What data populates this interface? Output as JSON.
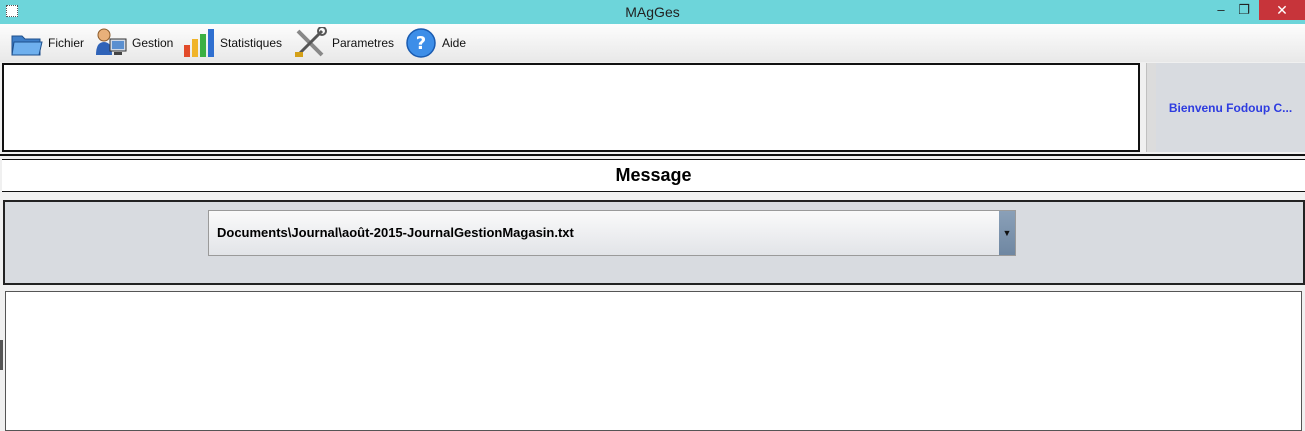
{
  "window": {
    "title": "MAgGes",
    "minimize_label": "–",
    "restore_label": "❐",
    "close_label": "✕"
  },
  "menu": {
    "items": [
      {
        "label": "Fichier",
        "icon": "folder-icon"
      },
      {
        "label": "Gestion",
        "icon": "user-computer-icon"
      },
      {
        "label": "Statistiques",
        "icon": "bar-chart-icon"
      },
      {
        "label": "Parametres",
        "icon": "tools-icon"
      },
      {
        "label": "Aide",
        "icon": "help-icon"
      }
    ]
  },
  "header": {
    "welcome": "Bienvenu Fodoup C..."
  },
  "message": {
    "title": "Message"
  },
  "journal": {
    "selected_file": "Documents\\Journal\\août-2015-JournalGestionMagasin.txt",
    "dropdown_arrow": "▼"
  },
  "colors": {
    "titlebar": "#6dd5da",
    "welcome_text": "#2e3ce0",
    "panel_bg": "#d8dbe0",
    "close_button": "#c7343a"
  }
}
